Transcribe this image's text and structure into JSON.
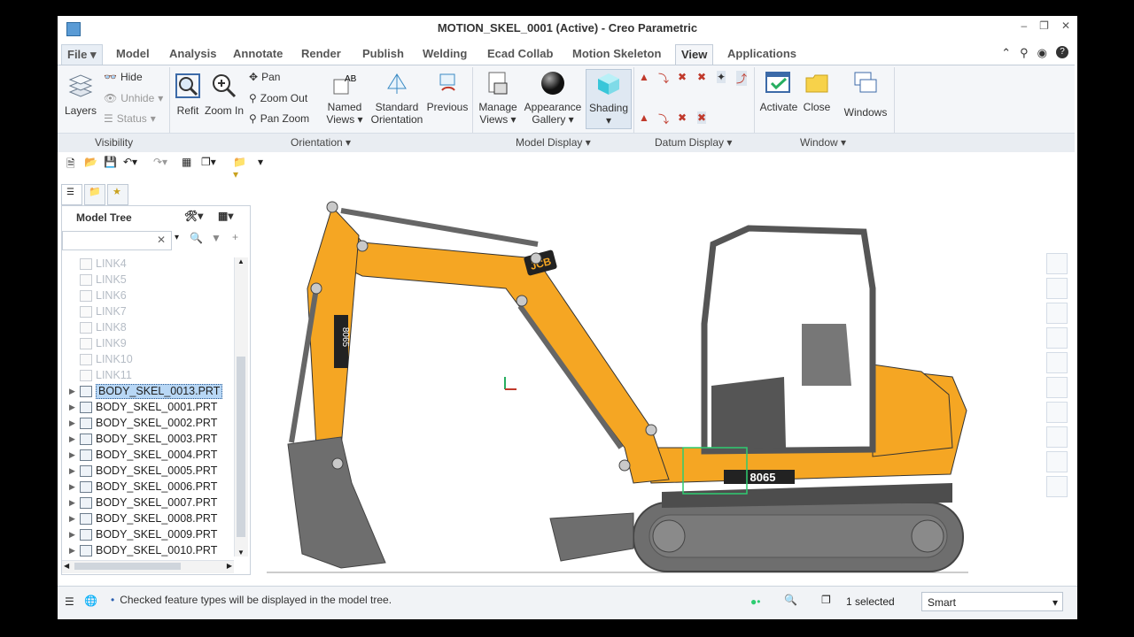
{
  "window": {
    "title": "MOTION_SKEL_0001 (Active) - Creo Parametric"
  },
  "menu_tabs": [
    "File",
    "Model",
    "Analysis",
    "Annotate",
    "Render",
    "Publish",
    "Welding",
    "Ecad Collab",
    "Motion Skeleton",
    "View",
    "Applications"
  ],
  "active_tab": "View",
  "ribbon": {
    "visibility": {
      "layers": "Layers",
      "hide": "Hide",
      "unhide": "Unhide",
      "status": "Status",
      "group_label": "Visibility"
    },
    "orientation": {
      "refit": "Refit",
      "zoom_in": "Zoom In",
      "pan": "Pan",
      "zoom_out": "Zoom Out",
      "pan_zoom": "Pan Zoom",
      "named_views": "Named",
      "named_views_2": "Views",
      "standard": "Standard",
      "standard_2": "Orientation",
      "previous": "Previous",
      "group_label": "Orientation"
    },
    "model_display": {
      "manage": "Manage",
      "manage_2": "Views",
      "appearance": "Appearance",
      "appearance_2": "Gallery",
      "shading": "Shading",
      "group_label": "Model Display"
    },
    "datum_display": {
      "group_label": "Datum Display"
    },
    "window": {
      "activate": "Activate",
      "close": "Close",
      "windows": "Windows",
      "group_label": "Window"
    }
  },
  "model_tree": {
    "title": "Model Tree",
    "search_placeholder": "",
    "items": [
      {
        "label": "LINK4",
        "dim": true
      },
      {
        "label": "LINK5",
        "dim": true
      },
      {
        "label": "LINK6",
        "dim": true
      },
      {
        "label": "LINK7",
        "dim": true
      },
      {
        "label": "LINK8",
        "dim": true
      },
      {
        "label": "LINK9",
        "dim": true
      },
      {
        "label": "LINK10",
        "dim": true
      },
      {
        "label": "LINK11",
        "dim": true
      },
      {
        "label": "BODY_SKEL_0013.PRT",
        "selected": true
      },
      {
        "label": "BODY_SKEL_0001.PRT"
      },
      {
        "label": "BODY_SKEL_0002.PRT"
      },
      {
        "label": "BODY_SKEL_0003.PRT"
      },
      {
        "label": "BODY_SKEL_0004.PRT"
      },
      {
        "label": "BODY_SKEL_0005.PRT"
      },
      {
        "label": "BODY_SKEL_0006.PRT"
      },
      {
        "label": "BODY_SKEL_0007.PRT"
      },
      {
        "label": "BODY_SKEL_0008.PRT"
      },
      {
        "label": "BODY_SKEL_0009.PRT"
      },
      {
        "label": "BODY_SKEL_0010.PRT"
      }
    ]
  },
  "canvas": {
    "brand": "JCB",
    "model": "8065"
  },
  "status": {
    "message": "Checked feature types will be displayed in the model tree.",
    "selected": "1 selected",
    "filter": "Smart"
  },
  "colors": {
    "excavator": "#f5a623",
    "ribbon_bg": "#f4f6f9",
    "accent": "#2b5fb0"
  }
}
